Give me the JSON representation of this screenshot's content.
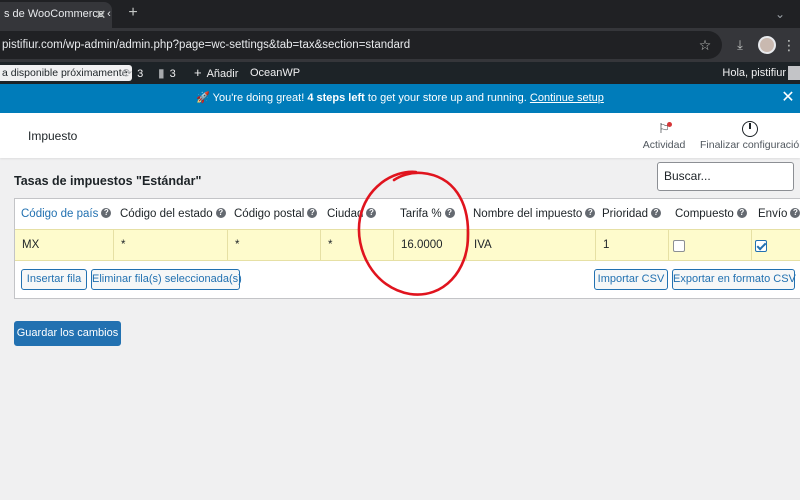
{
  "browser": {
    "tab_title": "s de WooCommerce ‹ ",
    "url": "pistifiur.com/wp-admin/admin.php?page=wc-settings&tab=tax&section=standard"
  },
  "adminbar": {
    "notice": "a disponible próximamente",
    "updates_count": "3",
    "comments_count": "3",
    "add_new_label": "Añadir",
    "theme_label": "OceanWP",
    "greeting": "Hola, pistifiur"
  },
  "banner": {
    "lead": "🚀 You're doing great!",
    "strong": "4 steps left",
    "rest": "to get your store up and running.",
    "link": "Continue setup"
  },
  "header": {
    "title": "Impuesto",
    "activity_label": "Actividad",
    "finish_label": "Finalizar configuración"
  },
  "section_title": "Tasas de impuestos \"Estándar\"",
  "search": {
    "placeholder": "Buscar..."
  },
  "table": {
    "columns": [
      "Código de país",
      "Código del estado",
      "Código postal",
      "Ciudad",
      "Tarifa %",
      "Nombre del impuesto",
      "Prioridad",
      "Compuesto",
      "Envío"
    ],
    "rows": [
      {
        "country": "MX",
        "state": "*",
        "postcode": "*",
        "city": "*",
        "rate": "16.0000",
        "name": "IVA",
        "priority": "1",
        "compound": false,
        "shipping": true
      }
    ]
  },
  "buttons": {
    "insert_row": "Insertar fila",
    "delete_rows": "Eliminar fila(s) seleccionada(s)",
    "import_csv": "Importar CSV",
    "export_csv": "Exportar en formato CSV",
    "save": "Guardar los cambios"
  },
  "colors": {
    "accent": "#2271b1",
    "banner": "#007cba",
    "row_highlight": "#fefbcc",
    "annotation": "#e0141e"
  }
}
